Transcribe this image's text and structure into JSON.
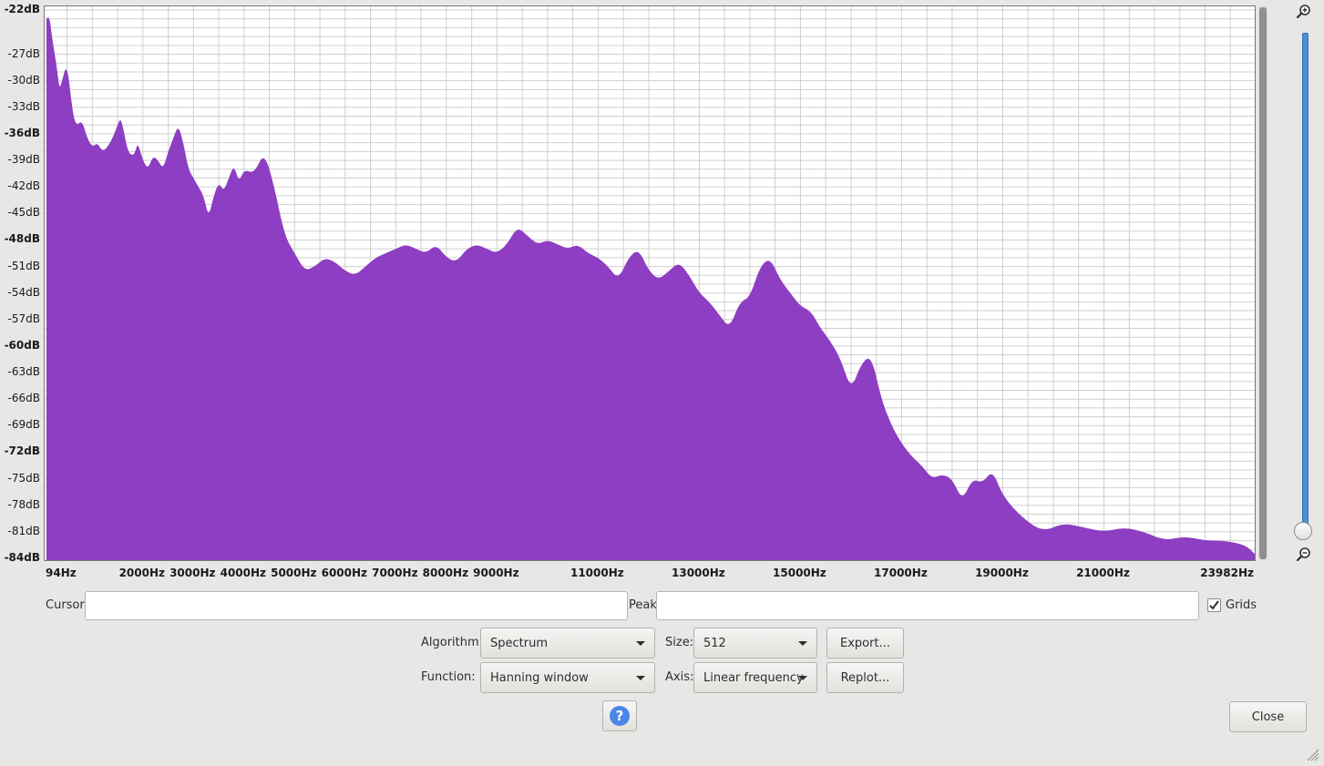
{
  "chart_data": {
    "type": "area",
    "xlabel": "",
    "ylabel": "",
    "xlim": [
      94,
      23982
    ],
    "ylim": [
      -84,
      -22
    ],
    "grid": true,
    "color": "#8e3ec2",
    "y_tick_labels": [
      "-22dB",
      "-27dB",
      "-30dB",
      "-33dB",
      "-36dB",
      "-39dB",
      "-42dB",
      "-45dB",
      "-48dB",
      "-51dB",
      "-54dB",
      "-57dB",
      "-60dB",
      "-63dB",
      "-66dB",
      "-69dB",
      "-72dB",
      "-75dB",
      "-78dB",
      "-81dB",
      "-84dB"
    ],
    "y_tick_values": [
      -22,
      -27,
      -30,
      -33,
      -36,
      -39,
      -42,
      -45,
      -48,
      -51,
      -54,
      -57,
      -60,
      -63,
      -66,
      -69,
      -72,
      -75,
      -78,
      -81,
      -84
    ],
    "y_major_ticks": [
      -22,
      -36,
      -48,
      -60,
      -72,
      -84
    ],
    "x_tick_labels": [
      "94Hz",
      "2000Hz",
      "3000Hz",
      "4000Hz",
      "5000Hz",
      "6000Hz",
      "7000Hz",
      "8000Hz",
      "9000Hz",
      "11000Hz",
      "13000Hz",
      "15000Hz",
      "17000Hz",
      "19000Hz",
      "21000Hz",
      "23982Hz"
    ],
    "x_tick_values": [
      94,
      2000,
      3000,
      4000,
      5000,
      6000,
      7000,
      8000,
      9000,
      11000,
      13000,
      15000,
      17000,
      19000,
      21000,
      23982
    ],
    "x": [
      94,
      150,
      200,
      300,
      350,
      400,
      500,
      600,
      650,
      700,
      800,
      900,
      1000,
      1100,
      1200,
      1300,
      1400,
      1500,
      1550,
      1600,
      1700,
      1800,
      1850,
      1900,
      2000,
      2100,
      2200,
      2300,
      2400,
      2500,
      2600,
      2700,
      2800,
      2900,
      3000,
      3100,
      3200,
      3300,
      3400,
      3500,
      3600,
      3700,
      3800,
      3900,
      4000,
      4200,
      4400,
      4600,
      4800,
      5000,
      5200,
      5400,
      5600,
      5800,
      6000,
      6200,
      6400,
      6600,
      6800,
      7000,
      7200,
      7400,
      7600,
      7800,
      8000,
      8200,
      8400,
      8600,
      8800,
      9000,
      9200,
      9400,
      9600,
      9800,
      10000,
      10200,
      10400,
      10600,
      10800,
      11000,
      11200,
      11400,
      11600,
      11800,
      12000,
      12200,
      12400,
      12600,
      12800,
      13000,
      13200,
      13400,
      13600,
      13800,
      14000,
      14200,
      14400,
      14600,
      14800,
      15000,
      15200,
      15400,
      15600,
      15800,
      16000,
      16200,
      16400,
      16600,
      16800,
      17000,
      17200,
      17400,
      17600,
      17800,
      18000,
      18200,
      18400,
      18600,
      18800,
      19000,
      19400,
      19800,
      20200,
      20600,
      21000,
      21400,
      21800,
      22200,
      22600,
      23000,
      23400,
      23800,
      23982
    ],
    "y": [
      -23,
      -22.5,
      -25,
      -28.5,
      -31,
      -30,
      -28,
      -33,
      -34.5,
      -35,
      -34.5,
      -36.5,
      -37.5,
      -37,
      -38,
      -37.5,
      -36.5,
      -35,
      -34.3,
      -35,
      -38,
      -38.5,
      -38,
      -37,
      -39,
      -40,
      -38.5,
      -39,
      -40,
      -38,
      -36.5,
      -35,
      -37,
      -40,
      -41,
      -42,
      -43,
      -45.5,
      -43,
      -41.5,
      -42.5,
      -41,
      -39.5,
      -41.5,
      -40,
      -40.5,
      -38,
      -42,
      -47.5,
      -49.5,
      -51.5,
      -51,
      -50,
      -50.5,
      -51.5,
      -52,
      -51,
      -50,
      -49.5,
      -49,
      -48.5,
      -49,
      -49.5,
      -48.5,
      -50,
      -50.5,
      -49,
      -48.5,
      -49,
      -49.5,
      -48.5,
      -46.5,
      -47.5,
      -48.5,
      -48,
      -48.5,
      -49,
      -48.5,
      -49.5,
      -50,
      -51,
      -52.5,
      -50,
      -49,
      -51.5,
      -52.5,
      -51.5,
      -50.5,
      -52,
      -54,
      -55,
      -56.5,
      -58,
      -55,
      -54.5,
      -51,
      -50,
      -52.5,
      -54,
      -55.5,
      -56,
      -58,
      -59.5,
      -61.5,
      -65,
      -62,
      -61,
      -66,
      -69,
      -71,
      -72.5,
      -73.5,
      -75,
      -74.5,
      -75,
      -77.5,
      -75,
      -75.5,
      -74,
      -77,
      -79.5,
      -81,
      -80,
      -80.5,
      -81,
      -80.5,
      -81,
      -82,
      -81.5,
      -82,
      -82,
      -82.5,
      -83.5,
      -82.5,
      -83,
      -84,
      -84.3,
      -84.5,
      -84.7,
      -84.9,
      -85,
      -85.5
    ]
  },
  "controls": {
    "cursor_label": "Cursor:",
    "cursor_value": "",
    "peak_label": "Peak:",
    "peak_value": "",
    "grids_label": "Grids",
    "grids_checked": true,
    "algorithm_label": "Algorithm:",
    "algorithm_value": "Spectrum",
    "size_label": "Size:",
    "size_value": "512",
    "function_label": "Function:",
    "function_value": "Hanning window",
    "axis_label": "Axis:",
    "axis_value": "Linear frequency",
    "export_label": "Export...",
    "replot_label": "Replot...",
    "close_label": "Close",
    "help_glyph": "?"
  },
  "icons": {
    "zoom_in": "zoom-in-icon",
    "zoom_out": "zoom-out-icon",
    "help": "help-icon",
    "resize": "resize-grip-icon"
  }
}
